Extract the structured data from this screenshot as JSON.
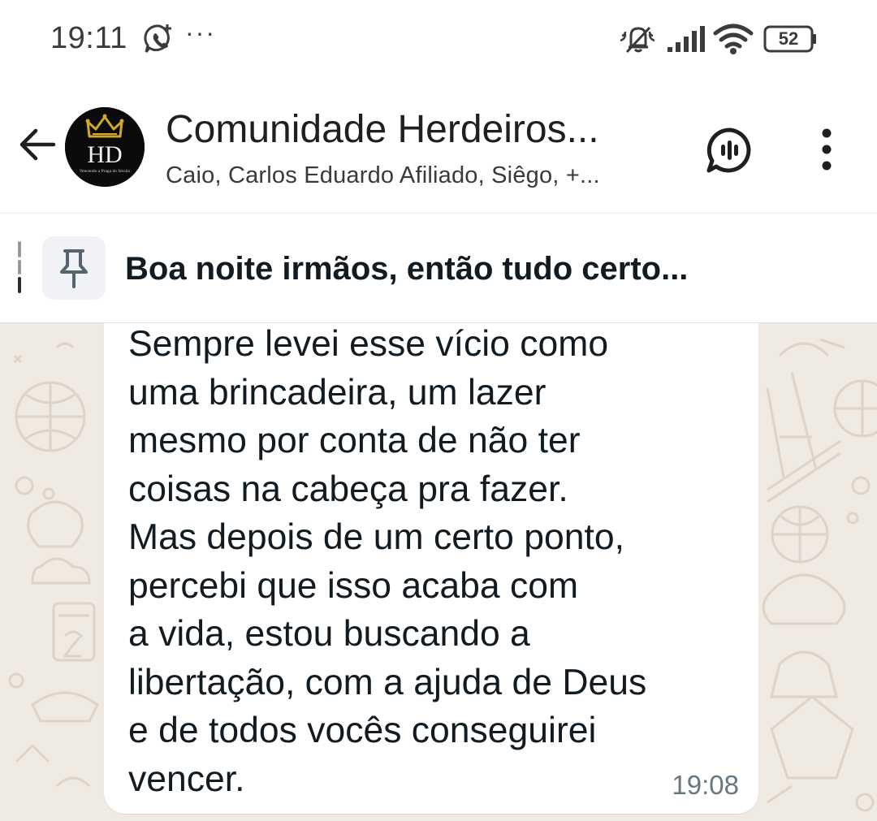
{
  "status_bar": {
    "time": "19:11",
    "overflow_dots": "···",
    "battery": "52",
    "icons": [
      "whatsapp-notification-icon",
      "mute-icon",
      "signal-icon",
      "wifi-icon",
      "battery-icon"
    ]
  },
  "header": {
    "title": "Comunidade Herdeiros...",
    "subtitle": "Caio, Carlos Eduardo Afiliado, Siêgo, +...",
    "avatar_initials": "HD",
    "avatar_tagline": "Vencendo a Praga do Século",
    "icons": [
      "back-arrow-icon",
      "voice-chat-icon",
      "more-vert-icon"
    ]
  },
  "pinned": {
    "text": "Boa noite irmãos, então tudo certo...",
    "icon": "pin-icon"
  },
  "message": {
    "lines": [
      "Sempre levei esse vício como",
      "uma brincadeira, um lazer",
      "mesmo por conta de não ter",
      "coisas na cabeça pra fazer.",
      "Mas depois de um certo ponto,",
      "percebi que isso acaba com",
      "a vida, estou buscando a",
      "libertação, com a ajuda de Deus",
      "e de todos vocês conseguirei",
      "vencer."
    ],
    "time": "19:08"
  },
  "colors": {
    "chat_background": "#efeae2",
    "bubble": "#ffffff",
    "crown_gold": "#d4a62a",
    "timestamp": "#667781"
  }
}
